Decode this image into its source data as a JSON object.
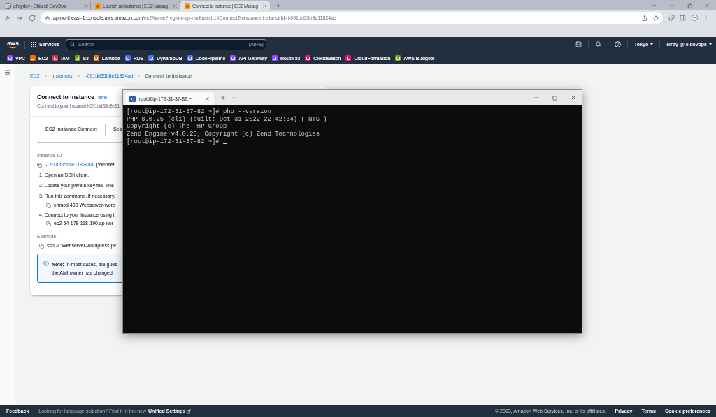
{
  "browser": {
    "tabs": [
      {
        "kind": "site",
        "title": "elroydev - Chia sẻ DevOps",
        "selected": false
      },
      {
        "kind": "aws",
        "title": "Launch an instance | EC2 Manag",
        "selected": false
      },
      {
        "kind": "aws",
        "title": "Connect to instance | EC2 Manag",
        "selected": true
      }
    ],
    "url": {
      "host": "ap-northeast-1.console.aws.amazon.com",
      "path": "/ec2/home?region=ap-northeast-1#ConnectToInstance:instanceId=i-091dd35b8e11824ad"
    }
  },
  "aws_nav": {
    "logo": "aws",
    "services": "Services",
    "search": {
      "placeholder": "Search",
      "shortcut": "[Alt+S]"
    },
    "region": "Tokyo",
    "account": "elroy @ eldevops"
  },
  "favorites": [
    {
      "label": "VPC",
      "color": "#8c4fff"
    },
    {
      "label": "EC2",
      "color": "#ed7100"
    },
    {
      "label": "IAM",
      "color": "#dd344c"
    },
    {
      "label": "S3",
      "color": "#7aa116"
    },
    {
      "label": "Lambda",
      "color": "#ed7100"
    },
    {
      "label": "RDS",
      "color": "#4d72f3"
    },
    {
      "label": "DynamoDB",
      "color": "#4d72f3"
    },
    {
      "label": "CodePipeline",
      "color": "#4d72f3"
    },
    {
      "label": "API Gateway",
      "color": "#8c4fff"
    },
    {
      "label": "Route 53",
      "color": "#8c4fff"
    },
    {
      "label": "CloudWatch",
      "color": "#e7157b"
    },
    {
      "label": "CloudFormation",
      "color": "#e7157b"
    },
    {
      "label": "AWS Budgets",
      "color": "#7aa116"
    }
  ],
  "breadcrumbs": [
    {
      "label": "EC2",
      "current": false
    },
    {
      "label": "Instances",
      "current": false
    },
    {
      "label": "i-091dd35b8e11824ad",
      "current": false
    },
    {
      "label": "Connect to instance",
      "current": true
    }
  ],
  "connect_panel": {
    "title": "Connect to instance",
    "info": "Info",
    "subtitle": "Connect to your instance i-091dd35b8e11",
    "tabs": [
      {
        "label": "EC2 Instance Connect",
        "selected": false
      },
      {
        "label": "Ses",
        "selected": false
      }
    ],
    "instance_id_label": "Instance ID",
    "instance_id": "i-091dd35b8e11824ad",
    "instance_name": "(Webser",
    "steps": [
      {
        "text": "1. Open an SSH client."
      },
      {
        "text": "2. Locate your private key file. The"
      },
      {
        "text": "3. Run this command, if necessary,",
        "code": "chmod 400 Webserver-word"
      },
      {
        "text": "4. Connect to your instance using it",
        "code": "ec2-54-178-118-190.ap-nor"
      }
    ],
    "example_label": "Example:",
    "example": "ssh -i \"Webserver-wordpress.pe",
    "note": [
      "**Note:** In most cases, the gues",
      "the AMI owner has changed"
    ]
  },
  "terminal": {
    "tab_title": "root@ip-172-31-37-82:~",
    "lines": [
      {
        "text": "[root@ip-172-31-37-82 ~]# php --version",
        "cursor": false
      },
      {
        "text": "PHP 8.0.25 (cli) (built: Oct 31 2022 22:42:34) ( NTS )",
        "cursor": false
      },
      {
        "text": "Copyright (c) The PHP Group",
        "cursor": false
      },
      {
        "text": "Zend Engine v4.0.25, Copyright (c) Zend Technologies",
        "cursor": false
      },
      {
        "text": "[root@ip-172-31-37-82 ~]#",
        "cursor": true
      }
    ]
  },
  "footer": {
    "feedback": "Feedback",
    "language_hint": "Looking for language selection? Find it in the new",
    "settings_link": "Unified Settings",
    "copyright": "© 2023, Amazon Web Services, Inc. or its affiliates.",
    "links": [
      "Privacy",
      "Terms",
      "Cookie preferences"
    ]
  }
}
